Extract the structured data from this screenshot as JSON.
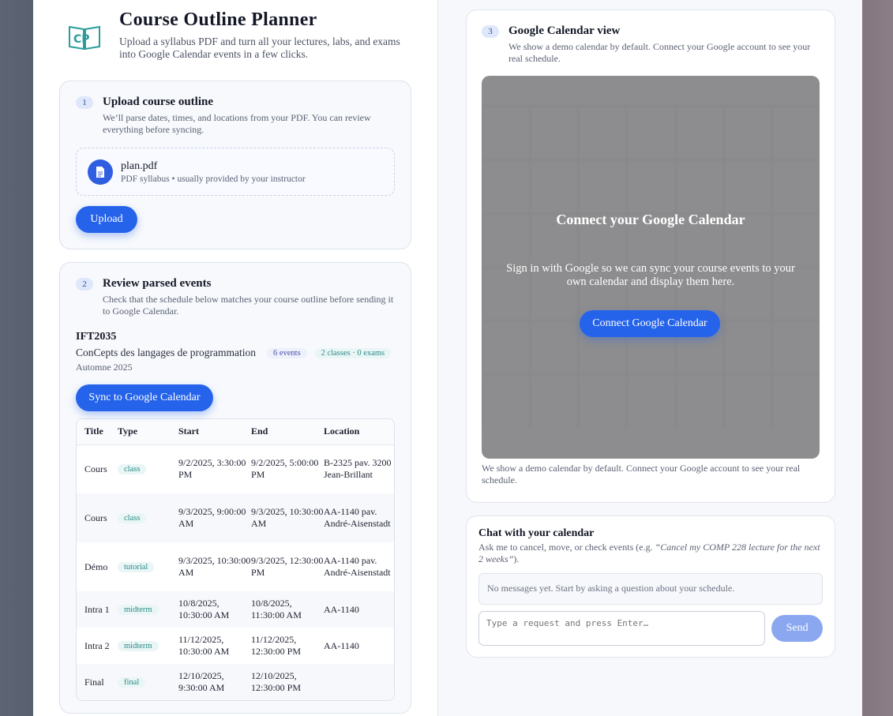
{
  "header": {
    "title": "Course Outline Planner",
    "subtitle": "Upload a syllabus PDF and turn all your lectures, labs, and exams into Google Calendar events in a few clicks.",
    "logo_text": "CP"
  },
  "upload": {
    "step": "1",
    "title": "Upload course outline",
    "desc": "We’ll parse dates, times, and locations from your PDF. You can review everything before syncing.",
    "file_name": "plan.pdf",
    "file_meta": "PDF syllabus • usually provided by your instructor",
    "button": "Upload"
  },
  "review": {
    "step": "2",
    "title": "Review parsed events",
    "desc": "Check that the schedule below matches your course outline before sending it to Google Calendar.",
    "course_code": "IFT2035",
    "course_name": "ConCepts des langages de programmation",
    "events_pill": "6 events",
    "classes_pill": "2 classes · 0 exams",
    "term": "Automne 2025",
    "sync_button": "Sync to Google Calendar",
    "columns": [
      "Title",
      "Type",
      "Start",
      "End",
      "Location"
    ],
    "rows": [
      {
        "title": "Cours",
        "type": "class",
        "start": "9/2/2025, 3:30:00 PM",
        "end": "9/2/2025, 5:00:00 PM",
        "location": "B-2325 pav. 3200 Jean-Brillant"
      },
      {
        "title": "Cours",
        "type": "class",
        "start": "9/3/2025, 9:00:00 AM",
        "end": "9/3/2025, 10:30:00 AM",
        "location": "AA-1140 pav. André-Aisenstadt"
      },
      {
        "title": "Démo",
        "type": "tutorial",
        "start": "9/3/2025, 10:30:00 AM",
        "end": "9/3/2025, 12:30:00 PM",
        "location": "AA-1140 pav. André-Aisenstadt"
      },
      {
        "title": "Intra 1",
        "type": "midterm",
        "start": "10/8/2025, 10:30:00 AM",
        "end": "10/8/2025, 11:30:00 AM",
        "location": "AA-1140"
      },
      {
        "title": "Intra 2",
        "type": "midterm",
        "start": "11/12/2025, 10:30:00 AM",
        "end": "11/12/2025, 12:30:00 PM",
        "location": "AA-1140"
      },
      {
        "title": "Final",
        "type": "final",
        "start": "12/10/2025, 9:30:00 AM",
        "end": "12/10/2025, 12:30:00 PM",
        "location": ""
      }
    ]
  },
  "calendar": {
    "step": "3",
    "title": "Google Calendar view",
    "desc": "We show a demo calendar by default. Connect your Google account to see your real schedule.",
    "overlay_title": "Connect your Google Calendar",
    "overlay_text": "Sign in with Google so we can sync your course events to your own calendar and display them here.",
    "connect_button": "Connect Google Calendar",
    "note": "We show a demo calendar by default. Connect your Google account to see your real schedule."
  },
  "chat": {
    "title": "Chat with your calendar",
    "desc_prefix": "Ask me to cancel, move, or check events (e.g. ",
    "desc_example": "“Cancel my COMP 228 lecture for the next 2 weeks”",
    "desc_suffix": ").",
    "empty": "No messages yet. Start by asking a question about your schedule.",
    "input_placeholder": "Type a request and press Enter…",
    "send_button": "Send"
  }
}
